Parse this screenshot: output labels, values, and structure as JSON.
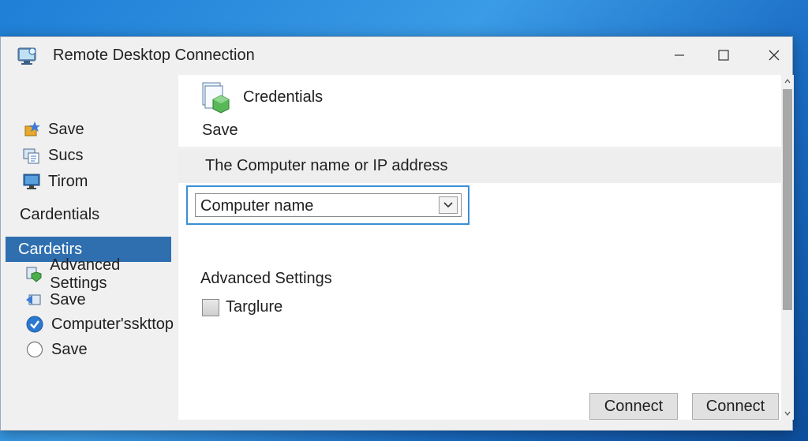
{
  "window": {
    "title": "Remote Desktop Connection",
    "icon": "remote-desktop-icon"
  },
  "sidebar": {
    "top_items": [
      {
        "label": "Save",
        "icon": "save-star-icon"
      },
      {
        "label": "Sucs",
        "icon": "document-icon"
      },
      {
        "label": "Tirom",
        "icon": "monitor-icon"
      }
    ],
    "heading": "Cardentials",
    "selected": "Cardetirs",
    "bottom_items": [
      {
        "label": "Advanced Settings",
        "icon": "settings-shield-icon"
      },
      {
        "label": "Save",
        "icon": "arrow-back-icon"
      },
      {
        "label": "Computer'sskttop",
        "icon": "check-circle-icon"
      },
      {
        "label": "Save",
        "icon": "radio-empty-icon"
      }
    ]
  },
  "content": {
    "header_title": "Credentials",
    "header_subtitle": "Save",
    "header_icon": "credentials-cube-icon",
    "section_label": "The Computer name or IP address",
    "combo_value": "Computer name",
    "advanced_label": "Advanced Settings",
    "checkbox_label": "Targlure",
    "checkbox_checked": false
  },
  "buttons": {
    "connect_1": "Connect",
    "connect_2": "Connect"
  },
  "colors": {
    "accent": "#2f6fb0",
    "focus_border": "#3a8fd6",
    "desktop": "#1e7fd6"
  }
}
